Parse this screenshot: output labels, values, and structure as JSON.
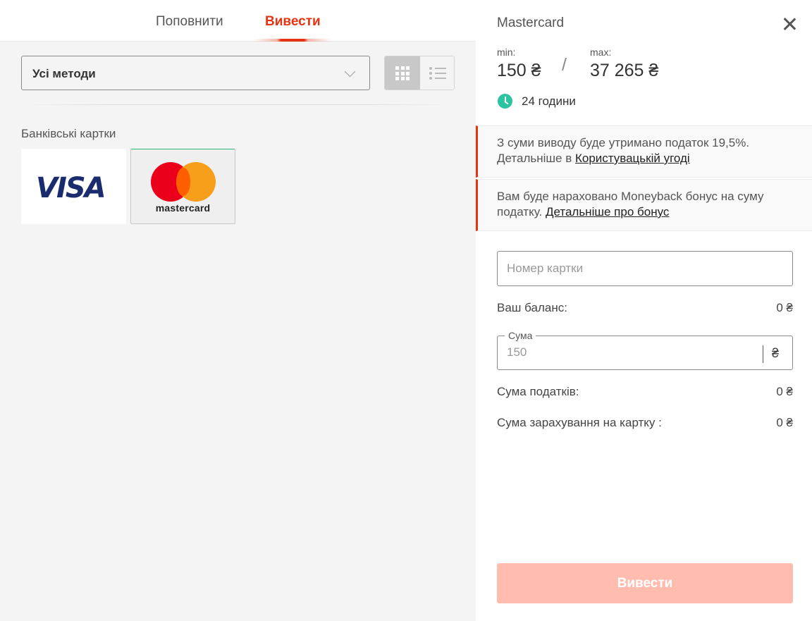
{
  "tabs": {
    "deposit_label": "Поповнити",
    "withdraw_label": "Вивести",
    "active": "withdraw"
  },
  "filter": {
    "method_selected": "Усі методи"
  },
  "view_toggle": {
    "grid_icon": "grid-icon",
    "list_icon": "list-icon",
    "active": "grid"
  },
  "methods": {
    "section_title": "Банківські картки",
    "items": [
      {
        "name": "VISA",
        "logo_text": "VISA",
        "selected": false
      },
      {
        "name": "Mastercard",
        "logo_text": "mastercard",
        "selected": true
      }
    ]
  },
  "details": {
    "title": "Mastercard",
    "min_label": "min:",
    "min_value": "150 ₴",
    "separator": "/",
    "max_label": "max:",
    "max_value": "37 265 ₴",
    "processing_time": "24 години",
    "notices": [
      {
        "text": "З суми виводу буде утримано податок 19,5%. Детальніше в ",
        "link": "Користувацькій угоді"
      },
      {
        "text": "Вам буде нараховано Moneyback бонус на суму податку. ",
        "link": "Детальніше про бонус"
      }
    ],
    "card_number_placeholder": "Номер картки",
    "balance_label": "Ваш баланс:",
    "balance_value": "0 ₴",
    "sum_legend": "Сума",
    "sum_placeholder": "150",
    "currency_symbol": "₴",
    "tax_label": "Сума податків:",
    "tax_value": "0 ₴",
    "credit_label": "Сума зарахування на картку :",
    "credit_value": "0 ₴",
    "submit_label": "Вивести"
  },
  "colors": {
    "accent": "#e63312",
    "submit_disabled": "#ffbcaf",
    "clock": "#2bc4a0",
    "visa_blue": "#1a2c6e",
    "mc_red": "#eb001b",
    "mc_yellow": "#f79e1b"
  }
}
